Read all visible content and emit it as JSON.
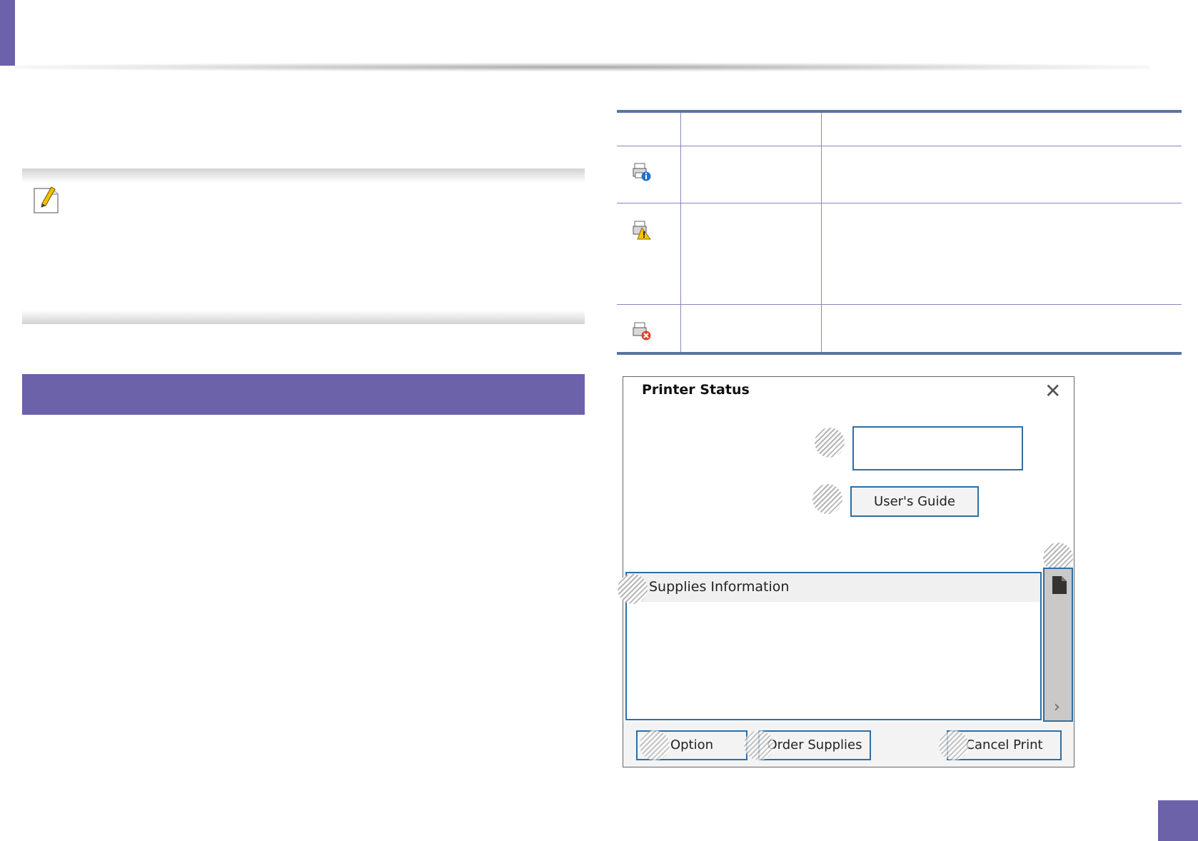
{
  "dialog": {
    "title": "Printer Status",
    "close_glyph": "✕",
    "users_guide_label": "User's Guide",
    "supplies_label": "Supplies Information",
    "option_label": "Option",
    "order_supplies_label": "Order Supplies",
    "cancel_print_label": "Cancel Print",
    "next_glyph": "›"
  },
  "status_icons": [
    "printer-info-icon",
    "printer-warning-icon",
    "printer-error-icon"
  ],
  "colors": {
    "accent": "#6b62aa",
    "dialog_border_blue": "#2f6ea5",
    "table_rule": "#5a74a0"
  }
}
